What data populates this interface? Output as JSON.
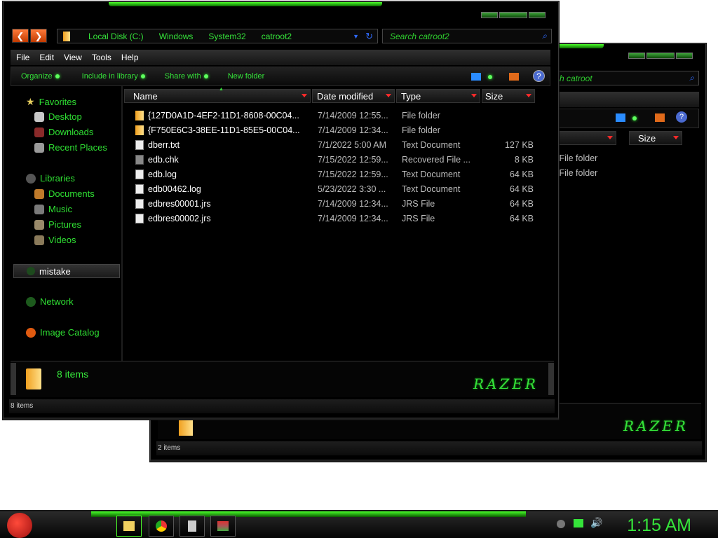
{
  "back_window": {
    "search_placeholder": "Search catroot",
    "search_partial": "h catroot",
    "col_type": "Type",
    "col_size": "Size",
    "rows": [
      "File folder",
      "File folder"
    ],
    "row_prefix": "e",
    "status": "2 items"
  },
  "front_window": {
    "breadcrumbs": [
      "Local Disk (C:)",
      "Windows",
      "System32",
      "catroot2"
    ],
    "search_placeholder": "Search catroot2",
    "menu": [
      "File",
      "Edit",
      "View",
      "Tools",
      "Help"
    ],
    "toolbar": [
      "Organize",
      "Include in library",
      "Share with",
      "New folder"
    ],
    "nav": {
      "favorites_header": "Favorites",
      "favorites": [
        "Desktop",
        "Downloads",
        "Recent Places"
      ],
      "libraries_header": "Libraries",
      "libraries": [
        "Documents",
        "Music",
        "Pictures",
        "Videos"
      ],
      "selected": "mistake",
      "network": "Network",
      "image_catalog": "Image Catalog"
    },
    "columns": [
      "Name",
      "Date modified",
      "Type",
      "Size"
    ],
    "files": [
      {
        "name": "{127D0A1D-4EF2-11D1-8608-00C04...",
        "date": "7/14/2009 12:55...",
        "type": "File folder",
        "size": "",
        "icon": "folder"
      },
      {
        "name": "{F750E6C3-38EE-11D1-85E5-00C04...",
        "date": "7/14/2009 12:34...",
        "type": "File folder",
        "size": "",
        "icon": "folder"
      },
      {
        "name": "dberr.txt",
        "date": "7/1/2022 5:00 AM",
        "type": "Text Document",
        "size": "127 KB",
        "icon": "doc"
      },
      {
        "name": "edb.chk",
        "date": "7/15/2022 12:59...",
        "type": "Recovered File ...",
        "size": "8 KB",
        "icon": "chk"
      },
      {
        "name": "edb.log",
        "date": "7/15/2022 12:59...",
        "type": "Text Document",
        "size": "64 KB",
        "icon": "doc"
      },
      {
        "name": "edb00462.log",
        "date": "5/23/2022 3:30 ...",
        "type": "Text Document",
        "size": "64 KB",
        "icon": "doc"
      },
      {
        "name": "edbres00001.jrs",
        "date": "7/14/2009 12:34...",
        "type": "JRS File",
        "size": "64 KB",
        "icon": "doc"
      },
      {
        "name": "edbres00002.jrs",
        "date": "7/14/2009 12:34...",
        "type": "JRS File",
        "size": "64 KB",
        "icon": "doc"
      }
    ],
    "details_count": "8 items",
    "status": "8 items",
    "brand": "RAZER"
  },
  "taskbar": {
    "clock": "1:15 AM"
  },
  "colors": {
    "accent": "#35e43a",
    "background": "#000000",
    "header_arrow": "#ff2a2a"
  }
}
